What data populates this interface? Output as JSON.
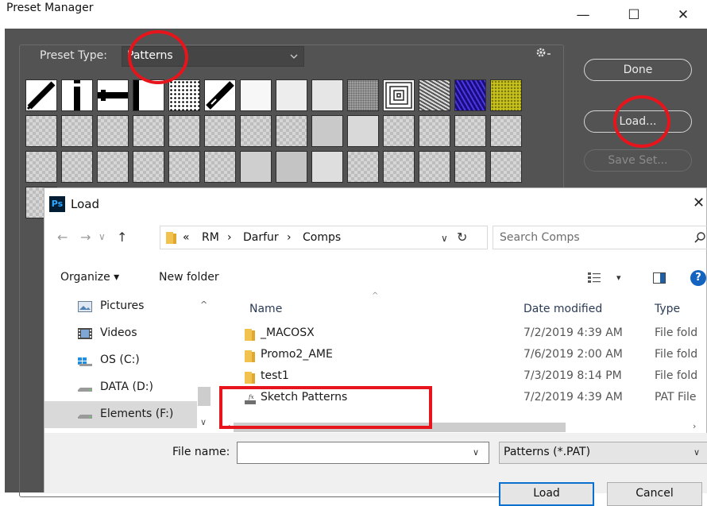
{
  "preset_manager": {
    "title": "Preset Manager",
    "preset_type_label": "Preset Type:",
    "preset_type_value": "Patterns",
    "buttons": {
      "done": "Done",
      "load": "Load...",
      "save_set": "Save Set..."
    },
    "window_controls": {
      "minimize": "—",
      "maximize": "☐",
      "close": "✕"
    }
  },
  "load_dialog": {
    "title": "Load",
    "logo_text": "Ps",
    "close": "✕",
    "breadcrumb": {
      "prefix": "«",
      "separator": "›",
      "items": [
        "RM",
        "Darfur",
        "Comps"
      ]
    },
    "search": {
      "placeholder": "Search Comps"
    },
    "toolbar": {
      "organize": "Organize ▾",
      "new_folder": "New folder"
    },
    "nav_items": [
      {
        "label": "Pictures",
        "icon": "pictures-icon"
      },
      {
        "label": "Videos",
        "icon": "videos-icon"
      },
      {
        "label": "OS (C:)",
        "icon": "os-drive-icon"
      },
      {
        "label": "DATA (D:)",
        "icon": "drive-icon"
      },
      {
        "label": "Elements (F:)",
        "icon": "drive-icon",
        "selected": true
      }
    ],
    "columns": {
      "name": "Name",
      "date": "Date modified",
      "type": "Type"
    },
    "files": [
      {
        "name": "_MACOSX",
        "date": "7/2/2019 4:39 AM",
        "type": "File fold",
        "icon": "folder-icon"
      },
      {
        "name": "Promo2_AME",
        "date": "7/6/2019 2:00 AM",
        "type": "File fold",
        "icon": "folder-icon"
      },
      {
        "name": "test1",
        "date": "7/3/2019 8:14 PM",
        "type": "File fold",
        "icon": "folder-icon"
      },
      {
        "name": "Sketch Patterns",
        "date": "7/2/2019 4:39 AM",
        "type": "PAT File",
        "icon": "pat-file-icon"
      }
    ],
    "file_name_label": "File name:",
    "file_name_value": "",
    "file_type_value": "Patterns (*.PAT)",
    "buttons": {
      "load": "Load",
      "cancel": "Cancel"
    }
  },
  "colors": {
    "annotation": "#e8141b",
    "panel": "#535353",
    "accent": "#0b6fd1"
  }
}
